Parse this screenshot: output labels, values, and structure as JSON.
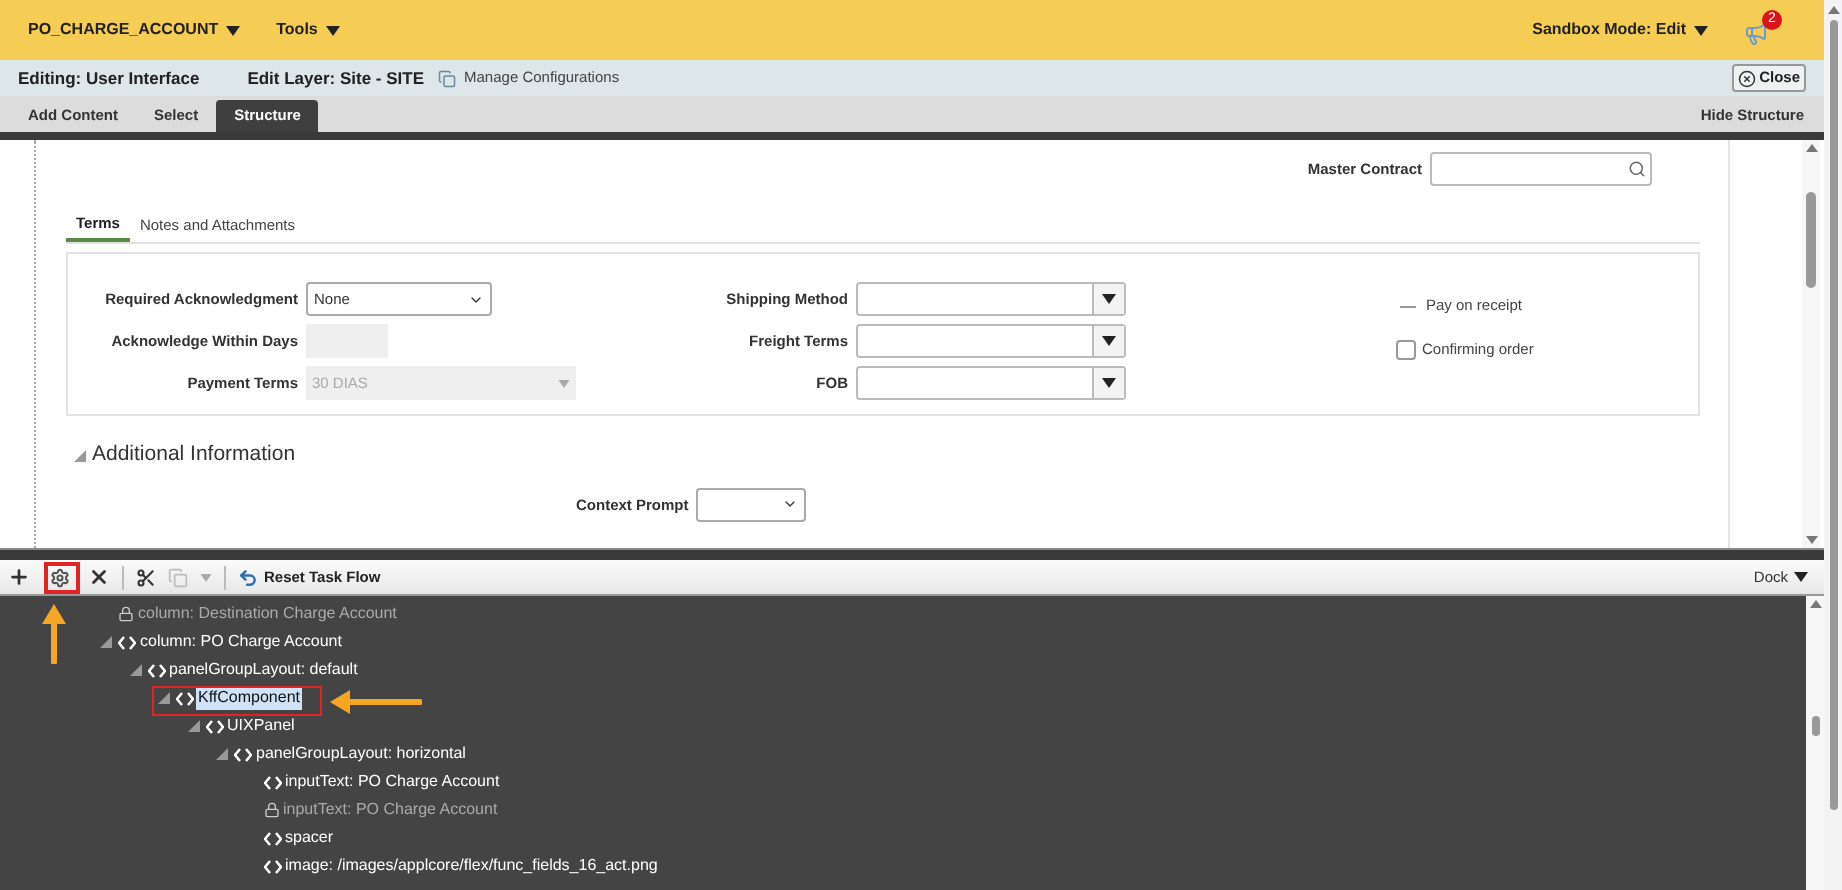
{
  "header": {
    "menus": [
      {
        "label": "PO_CHARGE_ACCOUNT"
      },
      {
        "label": "Tools"
      }
    ],
    "sandbox_mode": "Sandbox Mode: Edit",
    "notification_count": "2"
  },
  "editor_bar": {
    "editing": "Editing: User Interface",
    "edit_layer": "Edit Layer: Site - SITE",
    "manage_link": "Manage Configurations",
    "close_button": "Close"
  },
  "mode_tabs": [
    {
      "label": "Add Content",
      "selected": false
    },
    {
      "label": "Select",
      "selected": false
    },
    {
      "label": "Structure",
      "selected": true
    }
  ],
  "hide_structure": "Hide Structure",
  "form": {
    "master_contract": {
      "label": "Master Contract"
    },
    "tabs": [
      {
        "label": "Terms",
        "selected": true
      },
      {
        "label": "Notes and Attachments",
        "selected": false
      }
    ],
    "left_fields": [
      {
        "label": "Required Acknowledgment",
        "kind": "select",
        "value": "None"
      },
      {
        "label": "Acknowledge Within Days",
        "kind": "readonly"
      },
      {
        "label": "Payment Terms",
        "kind": "disabled",
        "value": "30 DIAS"
      }
    ],
    "middle_fields": [
      {
        "label": "Shipping Method"
      },
      {
        "label": "Freight Terms"
      },
      {
        "label": "FOB"
      }
    ],
    "checks": [
      {
        "label": "Pay on receipt",
        "kind": "readonly"
      },
      {
        "label": "Confirming order",
        "kind": "checkbox",
        "checked": false
      }
    ],
    "section": {
      "title": "Additional Information",
      "expanded": true
    },
    "context_prompt": {
      "label": "Context Prompt"
    }
  },
  "structure": {
    "reset": "Reset Task Flow",
    "dock": "Dock",
    "tree": [
      {
        "label": "column: Destination Charge Account",
        "disabled": true,
        "selected": false
      },
      {
        "label": "column: PO Charge Account",
        "disabled": false,
        "selected": false,
        "expanded": true,
        "children": [
          {
            "label": "panelGroupLayout: default",
            "disabled": false,
            "selected": false,
            "expanded": true,
            "children": [
              {
                "label": "KffComponent",
                "disabled": false,
                "selected": true,
                "expanded": true,
                "children": [
                  {
                    "label": "UIXPanel",
                    "disabled": false,
                    "selected": false,
                    "expanded": true,
                    "children": [
                      {
                        "label": "panelGroupLayout: horizontal",
                        "disabled": false,
                        "selected": false,
                        "expanded": true,
                        "children": [
                          {
                            "label": "inputText: PO Charge Account",
                            "disabled": false,
                            "selected": false
                          },
                          {
                            "label": "inputText: PO Charge Account",
                            "disabled": true,
                            "selected": false
                          },
                          {
                            "label": "spacer",
                            "disabled": false,
                            "selected": false
                          },
                          {
                            "label": "image: /images/applcore/flex/func_fields_16_act.png",
                            "disabled": false,
                            "selected": false
                          }
                        ]
                      }
                    ]
                  }
                ]
              }
            ]
          }
        ]
      }
    ]
  }
}
